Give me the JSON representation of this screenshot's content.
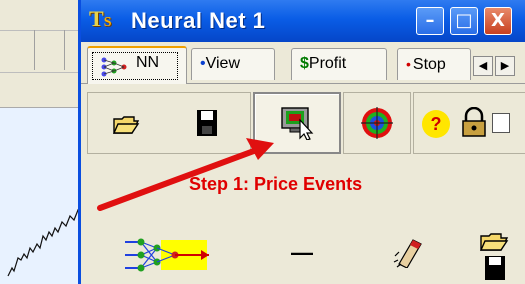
{
  "window": {
    "logo_text": "T",
    "logo_sub": "S",
    "title": "Neural Net  1",
    "minimize_glyph": "–",
    "maximize_glyph": "□",
    "close_glyph": "X"
  },
  "tabs": [
    {
      "label": "NN",
      "active": true
    },
    {
      "label": "View",
      "marker": "•"
    },
    {
      "label": "Profit",
      "marker": "$"
    },
    {
      "label": "Stop",
      "marker": "•"
    }
  ],
  "tab_scroll": {
    "left": "◀",
    "right": "▶"
  },
  "toolbar": {
    "icons": [
      "open-folder-icon",
      "save-disk-icon",
      "price-events-icon",
      "target-icon",
      "help-icon",
      "lock-icon"
    ],
    "help_label": "?"
  },
  "step_label": "Step 1: Price Events",
  "bottom": {
    "icons": [
      "neural-network-icon",
      "minus-icon",
      "eraser-icon",
      "folder-save-icon"
    ],
    "minus_label": "—"
  },
  "colors": {
    "accent_red": "#e00000",
    "title_blue": "#0a5de6"
  }
}
